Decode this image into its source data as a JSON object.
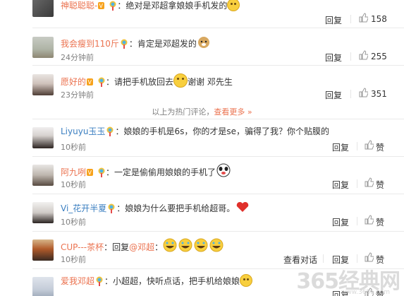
{
  "comments": [
    {
      "user": "神聪聪聪-",
      "text": "：绝对是邓超拿娘娘手机发的",
      "time": "",
      "reply": "回复",
      "likes": "158"
    },
    {
      "user": "我会瘦到110斤",
      "text": "：肯定是邓超发的",
      "time": "24分钟前",
      "reply": "回复",
      "likes": "255"
    },
    {
      "user": "愿好的",
      "text": "：请把手机放回去",
      "text2": "谢谢 邓先生",
      "time": "23分钟前",
      "reply": "回复",
      "likes": "351"
    },
    {
      "user": "Liyuyu玉玉",
      "text": "：娘娘的手机是6s，你的才是se，骗得了我？你个贴膜的",
      "time": "10秒前",
      "reply": "回复",
      "likes": "赞"
    },
    {
      "user": "阿九咧",
      "text": "：一定是偷偷用娘娘的手机了",
      "time": "10秒前",
      "reply": "回复",
      "likes": "赞"
    },
    {
      "user": "Vi_花开半夏",
      "text": "：娘娘为什么要把手机给超哥。",
      "time": "10秒前",
      "reply": "回复",
      "likes": "赞"
    },
    {
      "user": "CUP---茶杯",
      "text": "：回复",
      "mention": "@邓超",
      "text3": "：",
      "time": "10秒前",
      "reply": "回复",
      "likes": "赞",
      "view": "查看对话"
    },
    {
      "user": "爱我邓超",
      "text": "：小超超，快听点话，把手机给娘娘",
      "time": "",
      "reply": "回复",
      "likes": "赞"
    }
  ],
  "hot_text": "以上为热门评论，",
  "hot_more": "查看更多",
  "hot_arrow": "»",
  "watermark": "365经典网",
  "watermark_sub": "www.3651.com",
  "colors": {
    "name": "#eb7350",
    "link": "#eb7350",
    "gray": "#808080"
  }
}
